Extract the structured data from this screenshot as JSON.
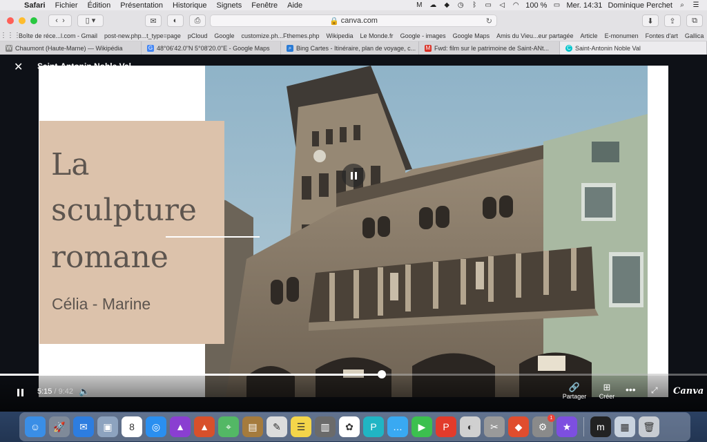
{
  "menubar": {
    "app": "Safari",
    "items": [
      "Fichier",
      "Édition",
      "Présentation",
      "Historique",
      "Signets",
      "Fenêtre",
      "Aide"
    ],
    "battery": "100 %",
    "clock": "Mer. 14:31",
    "user": "Dominique Perchet"
  },
  "toolbar": {
    "url": "canva.com"
  },
  "bookmarks": [
    "Boîte de réce...l.com - Gmail",
    "post-new.php...t_type=page",
    "pCloud",
    "Google",
    "customize.ph...Fthemes.php",
    "Wikipedia",
    "Le Monde.fr",
    "Google - images",
    "Google Maps",
    "Amis du Vieu...eur partagée",
    "Article",
    "E-monumen",
    "Fontes d'art",
    "Gallica"
  ],
  "tabs": [
    {
      "label": "Chaumont (Haute-Marne) — Wikipédia",
      "icon": "W",
      "color": "#777777"
    },
    {
      "label": "48°06'42.0\"N 5°08'20.0\"E - Google Maps",
      "icon": "G",
      "color": "#4285f4"
    },
    {
      "label": "Bing Cartes - Itinéraire, plan de voyage, c...",
      "icon": "⌕",
      "color": "#2a7bd5"
    },
    {
      "label": "Fwd: film sur le patrimoine de Saint-ANt...",
      "icon": "M",
      "color": "#d93025"
    },
    {
      "label": "Saint-Antonin Noble Val",
      "icon": "C",
      "color": "#00c4cc"
    }
  ],
  "viewer": {
    "title": "Saint-Antonin Noble Val"
  },
  "slide": {
    "title_lines": [
      "La",
      "sculpture",
      "romane"
    ],
    "subtitle": "Célia - Marine"
  },
  "player": {
    "current_time": "5:15",
    "total_time": "/ 9:42",
    "progress": 0.54,
    "share_label": "Partager",
    "create_label": "Créer",
    "brand": "Canva"
  },
  "dock": [
    {
      "name": "finder",
      "icon": "☺",
      "color": "#3a8ee6"
    },
    {
      "name": "launchpad",
      "icon": "🚀",
      "color": "#7f8a99"
    },
    {
      "name": "mail-app",
      "icon": "✉",
      "color": "#2d7de0"
    },
    {
      "name": "preview",
      "icon": "▣",
      "color": "#8da3bf"
    },
    {
      "name": "calendar",
      "icon": "8",
      "color": "#ffffff"
    },
    {
      "name": "safari",
      "icon": "◎",
      "color": "#2a8ff0"
    },
    {
      "name": "affinity-designer",
      "icon": "▲",
      "color": "#8a3fd1"
    },
    {
      "name": "affinity-publisher",
      "icon": "▲",
      "color": "#d8502b"
    },
    {
      "name": "maps",
      "icon": "⌖",
      "color": "#53b865"
    },
    {
      "name": "notes-book",
      "icon": "▤",
      "color": "#a57b3d"
    },
    {
      "name": "textedit",
      "icon": "✎",
      "color": "#dcdcdc"
    },
    {
      "name": "notes",
      "icon": "☰",
      "color": "#f4d54a"
    },
    {
      "name": "archive",
      "icon": "▥",
      "color": "#6b6b6b"
    },
    {
      "name": "photos",
      "icon": "✿",
      "color": "#ffffff"
    },
    {
      "name": "pcloud",
      "icon": "P",
      "color": "#20b5c4"
    },
    {
      "name": "messages",
      "icon": "…",
      "color": "#39a9f2"
    },
    {
      "name": "facetime",
      "icon": "▶",
      "color": "#3cc04f"
    },
    {
      "name": "pdf-app",
      "icon": "P",
      "color": "#e23b2b"
    },
    {
      "name": "activity",
      "icon": "◐",
      "color": "#d0d0d0"
    },
    {
      "name": "script",
      "icon": "✂",
      "color": "#9a9a9a"
    },
    {
      "name": "sketch",
      "icon": "◆",
      "color": "#e04d2e"
    },
    {
      "name": "system-preferences",
      "icon": "⚙",
      "color": "#8a8a8a",
      "badge": "1"
    },
    {
      "name": "imovie",
      "icon": "★",
      "color": "#7d4fe0"
    },
    {
      "name": "meta-app",
      "icon": "m",
      "color": "#222222"
    },
    {
      "name": "downloads",
      "icon": "▦",
      "color": "#c9d3df"
    },
    {
      "name": "trash",
      "icon": "🗑",
      "color": "#c8ccd2"
    }
  ],
  "colors": {
    "title_box": "#dcc2ab",
    "title_text": "#5d554f",
    "viewer_bg": "#0e1117"
  }
}
